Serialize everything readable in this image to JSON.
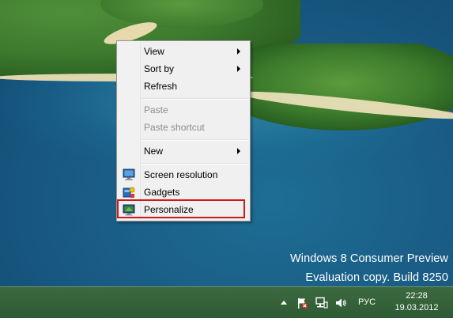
{
  "watermark": {
    "line1": "Windows 8 Consumer Preview",
    "line2": "Evaluation copy. Build 8250"
  },
  "context_menu": {
    "items": [
      {
        "label": "View",
        "submenu": true,
        "enabled": true
      },
      {
        "label": "Sort by",
        "submenu": true,
        "enabled": true
      },
      {
        "label": "Refresh",
        "submenu": false,
        "enabled": true
      },
      {
        "label": "Paste",
        "submenu": false,
        "enabled": false
      },
      {
        "label": "Paste shortcut",
        "submenu": false,
        "enabled": false
      },
      {
        "label": "New",
        "submenu": true,
        "enabled": true
      },
      {
        "label": "Screen resolution",
        "icon": "monitor-icon",
        "enabled": true
      },
      {
        "label": "Gadgets",
        "icon": "gadgets-icon",
        "enabled": true
      },
      {
        "label": "Personalize",
        "icon": "personalize-icon",
        "enabled": true,
        "highlighted": true
      }
    ]
  },
  "taskbar": {
    "language": "РУС",
    "time": "22:28",
    "date": "19.03.2012",
    "tray_icons": [
      "show-hidden-icons-arrow",
      "action-center-flag-icon",
      "network-icon",
      "volume-icon"
    ]
  },
  "colors": {
    "highlight_border": "#d01818",
    "taskbar": "#2e5a33",
    "menu_background": "#f0f0f0"
  }
}
